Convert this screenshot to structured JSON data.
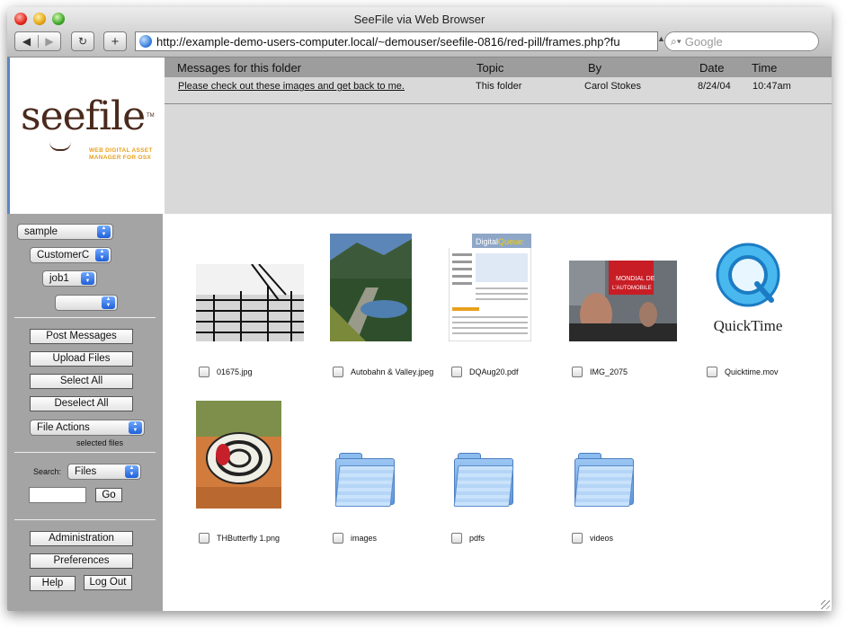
{
  "window": {
    "title": "SeeFile via Web Browser"
  },
  "toolbar": {
    "back_icon": "◀",
    "forward_icon": "▶",
    "reload_icon": "↻",
    "add_icon": "+",
    "url": "http://example-demo-users-computer.local/~demouser/seefile-0816/red-pill/frames.php?fu",
    "search_placeholder": "Google"
  },
  "logo": {
    "name": "seefile",
    "tm": "TM",
    "tagline_1": "WEB DIGITAL ASSET",
    "tagline_2": "MANAGER FOR OSX"
  },
  "messages": {
    "headers": {
      "subject": "Messages for this folder",
      "topic": "Topic",
      "by": "By",
      "date": "Date",
      "time": "Time"
    },
    "rows": [
      {
        "subject": "Please check out these images and get back to me.",
        "topic": "This folder",
        "by": "Carol Stokes",
        "date": "8/24/04",
        "time": "10:47am"
      }
    ]
  },
  "sidebar": {
    "select_1": "sample",
    "select_2": "CustomerC",
    "select_3": "job1",
    "select_4": "",
    "post_messages": "Post Messages",
    "upload_files": "Upload Files",
    "select_all": "Select All",
    "deselect_all": "Deselect All",
    "file_actions": "File Actions",
    "selected_files": "selected files",
    "search_label": "Search:",
    "search_scope": "Files",
    "search_value": "",
    "go": "Go",
    "administration": "Administration",
    "preferences": "Preferences",
    "help": "Help",
    "logout": "Log Out"
  },
  "files": [
    {
      "name": "01675.jpg"
    },
    {
      "name": "Autobahn & Valley.jpeg"
    },
    {
      "name": "DQAug20.pdf"
    },
    {
      "name": "IMG_2075"
    },
    {
      "name": "Quicktime.mov"
    },
    {
      "name": "THButterfly 1.png"
    },
    {
      "name": "images"
    },
    {
      "name": "pdfs"
    },
    {
      "name": "videos"
    }
  ],
  "thumb_text": {
    "dq_left": "Digital",
    "dq_right": "Queue:",
    "quicktime": "QuickTime",
    "banner_1": "MONDIAL DE",
    "banner_2": "L'AUTOMOBILE"
  },
  "colors": {
    "sidebar_bg": "#a4a4a4",
    "message_header_bg": "#9d9d9d",
    "logo_accent": "#e8a11d"
  }
}
